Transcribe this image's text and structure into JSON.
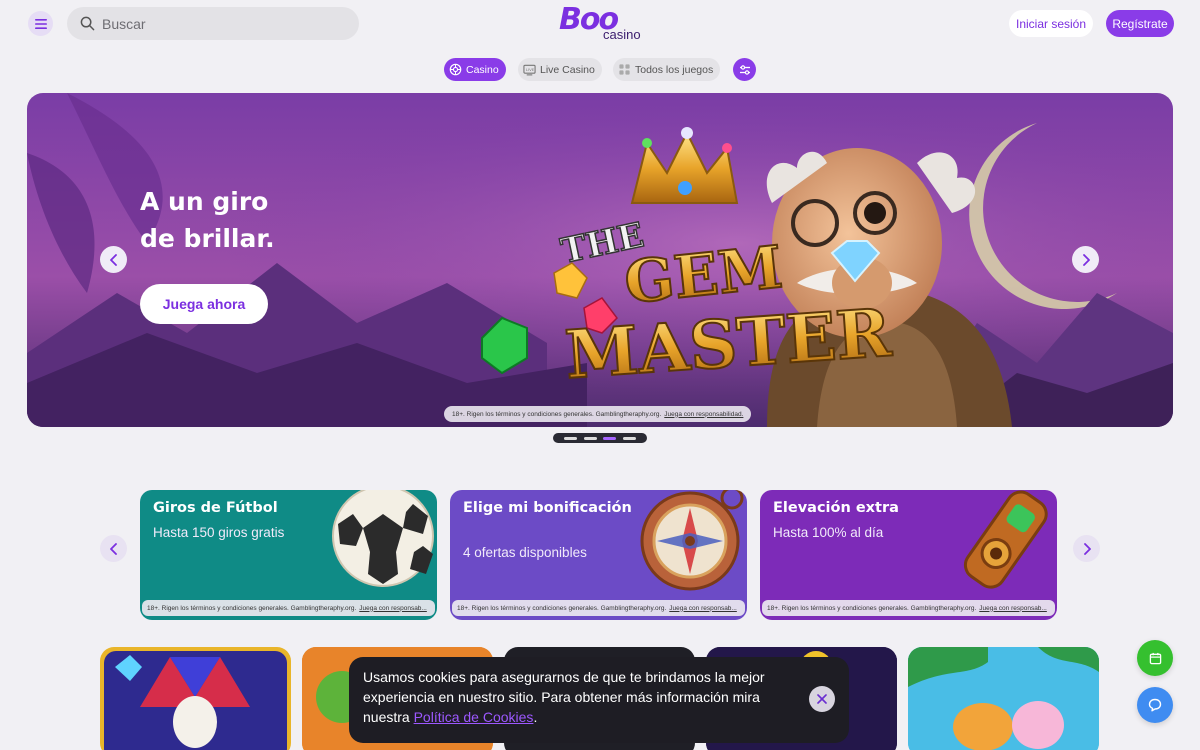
{
  "header": {
    "search_placeholder": "Buscar",
    "logo_main": "Boo",
    "logo_sub": "casino",
    "login_label": "Iniciar sesión",
    "register_label": "Regístrate"
  },
  "tabs": [
    {
      "label": "Casino",
      "icon": "casino-icon",
      "active": true
    },
    {
      "label": "Live Casino",
      "icon": "live-icon",
      "active": false
    },
    {
      "label": "Todos los juegos",
      "icon": "grid-icon",
      "active": false
    }
  ],
  "hero": {
    "title_line1": "A un giro",
    "title_line2": "de brillar.",
    "cta_label": "Juega ahora",
    "game_logo_the": "THE",
    "game_logo_line1": "GEM",
    "game_logo_line2": "MASTER",
    "disclaimer": "18+. Rigen los términos y condiciones generales. Gamblingtheraphy.org.",
    "disclaimer_link": "Juega con responsabilidad.",
    "slides": 4,
    "active_slide": 3
  },
  "promos": [
    {
      "title": "Giros de Fútbol",
      "subtitle": "Hasta 150 giros gratis",
      "color": "#0f8b86",
      "disclaimer": "18+. Rigen los términos y condiciones generales. Gamblingtheraphy.org.",
      "disclaimer_link": "Juega con responsab..."
    },
    {
      "title": "Elige mi bonificación",
      "subtitle": "4 ofertas disponibles",
      "color": "#6c4bc6",
      "disclaimer": "18+. Rigen los términos y condiciones generales. Gamblingtheraphy.org.",
      "disclaimer_link": "Juega con responsab..."
    },
    {
      "title": "Elevación extra",
      "subtitle": "Hasta 100% al día",
      "color": "#7d2bb8",
      "disclaimer": "18+. Rigen los términos y condiciones generales. Gamblingtheraphy.org.",
      "disclaimer_link": "Juega con responsab..."
    }
  ],
  "cookie": {
    "text": "Usamos cookies para asegurarnos de que te brindamos la mejor experiencia en nuestro sitio. Para obtener más información mira nuestra",
    "link": "Política de Cookies",
    "after": "."
  },
  "colors": {
    "accent": "#8a3ce8",
    "background": "#f1f0f4",
    "fab_calendar": "#35c02f",
    "fab_chat": "#3f8cf1"
  }
}
